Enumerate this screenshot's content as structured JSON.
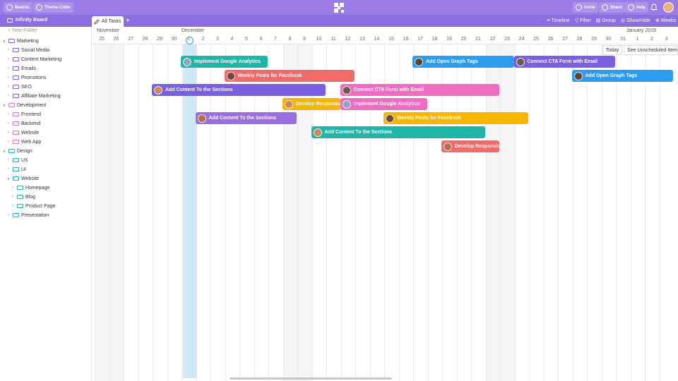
{
  "topbar": {
    "boards_label": "Boards",
    "theme_label": "Theme Color",
    "invite_label": "Invite",
    "share_label": "Share",
    "help_label": "Help"
  },
  "subbar": {
    "board_name": "Infinity Board",
    "tab_label": "All Tasks",
    "tools": {
      "timeline": "Timeline",
      "filter": "Filter",
      "group": "Group",
      "showhide": "Show/Hide",
      "weeks": "Weeks"
    }
  },
  "sidebar": {
    "new_folder": "New Folder",
    "items": [
      {
        "label": "Marketing",
        "level": 0,
        "open": true
      },
      {
        "label": "Social Media",
        "level": 1,
        "open": false
      },
      {
        "label": "Content Marketing",
        "level": 1,
        "open": false
      },
      {
        "label": "Emails",
        "level": 1,
        "open": false
      },
      {
        "label": "Promotions",
        "level": 1,
        "open": false
      },
      {
        "label": "SEO",
        "level": 1,
        "open": false
      },
      {
        "label": "Affiliate Marketing",
        "level": 1,
        "open": false
      },
      {
        "label": "Development",
        "level": 0,
        "open": true
      },
      {
        "label": "Frontend",
        "level": 1,
        "open": false
      },
      {
        "label": "Backend",
        "level": 1,
        "open": false
      },
      {
        "label": "Website",
        "level": 1,
        "open": false
      },
      {
        "label": "Web App",
        "level": 1,
        "open": false
      },
      {
        "label": "Design",
        "level": 0,
        "open": true
      },
      {
        "label": "UX",
        "level": 1,
        "open": false
      },
      {
        "label": "UI",
        "level": 1,
        "open": false
      },
      {
        "label": "Website",
        "level": 1,
        "open": true
      },
      {
        "label": "Homepage",
        "level": 2,
        "open": false
      },
      {
        "label": "Blog",
        "level": 2,
        "open": false
      },
      {
        "label": "Product Page",
        "level": 2,
        "open": false
      },
      {
        "label": "Presentation",
        "level": 1,
        "open": false
      }
    ]
  },
  "timeline": {
    "months": [
      "November",
      "December",
      "January 2019"
    ],
    "days": [
      "25",
      "26",
      "27",
      "28",
      "29",
      "30",
      "1",
      "2",
      "3",
      "4",
      "5",
      "6",
      "7",
      "8",
      "9",
      "10",
      "11",
      "12",
      "13",
      "14",
      "15",
      "16",
      "17",
      "18",
      "19",
      "20",
      "21",
      "22",
      "23",
      "24",
      "25",
      "26",
      "27",
      "28",
      "29",
      "30",
      "31",
      "1",
      "2",
      "3"
    ],
    "today_label": "Today",
    "unscheduled_label": "See Unscheduled Items",
    "tasks": [
      {
        "label": "Implement Google Analytics",
        "color": "#1fb5a8",
        "avatar": "#8fa7c7",
        "start": 6,
        "span": 6,
        "row": 0
      },
      {
        "label": "Add Open Graph Tags",
        "color": "#2d9cf0",
        "avatar": "#5b4636",
        "start": 22,
        "span": 7,
        "row": 0
      },
      {
        "label": "Connect CTA Form with Email",
        "color": "#7a5fe0",
        "avatar": "#6a5a4c",
        "start": 29,
        "span": 7,
        "row": 0
      },
      {
        "label": "Weekly Posts for Facebook",
        "color": "#f26a6a",
        "avatar": "#6b4a3a",
        "start": 9,
        "span": 9,
        "row": 1
      },
      {
        "label": "Add Open Graph Tags",
        "color": "#2d9cf0",
        "avatar": "#5b4636",
        "start": 33,
        "span": 7,
        "row": 1
      },
      {
        "label": "Add Content To the Sections",
        "color": "#7a5fe0",
        "avatar": "#c98a5a",
        "start": 4,
        "span": 12,
        "row": 2
      },
      {
        "label": "Connect CTA Form with Email",
        "color": "#f06bc2",
        "avatar": "#6a5a4c",
        "start": 17,
        "span": 11,
        "row": 2
      },
      {
        "label": "Develop Responsive Layout",
        "color": "#f7b500",
        "avatar": "#c98a5a",
        "start": 13,
        "span": 4,
        "row": 3
      },
      {
        "label": "Implement Google Analytics",
        "color": "#f06bc2",
        "avatar": "#8fa7c7",
        "start": 17,
        "span": 6,
        "row": 3
      },
      {
        "label": "Add Content To the Sections",
        "color": "#9b6ee0",
        "avatar": "#b0704c",
        "start": 7,
        "span": 7,
        "row": 4
      },
      {
        "label": "Weekly Posts for Facebook",
        "color": "#f7b500",
        "avatar": "#6b4a3a",
        "start": 20,
        "span": 10,
        "row": 4
      },
      {
        "label": "Add Content To the Sections",
        "color": "#1fb5a8",
        "avatar": "#c98a5a",
        "start": 15,
        "span": 12,
        "row": 5
      },
      {
        "label": "Develop Responsive Layout",
        "color": "#f26a6a",
        "avatar": "#b0704c",
        "start": 24,
        "span": 4,
        "row": 6
      }
    ]
  },
  "colors": {
    "accent": "#9b7be6",
    "accent_dark": "#8d6ee0",
    "today": "#3a8fd9"
  }
}
